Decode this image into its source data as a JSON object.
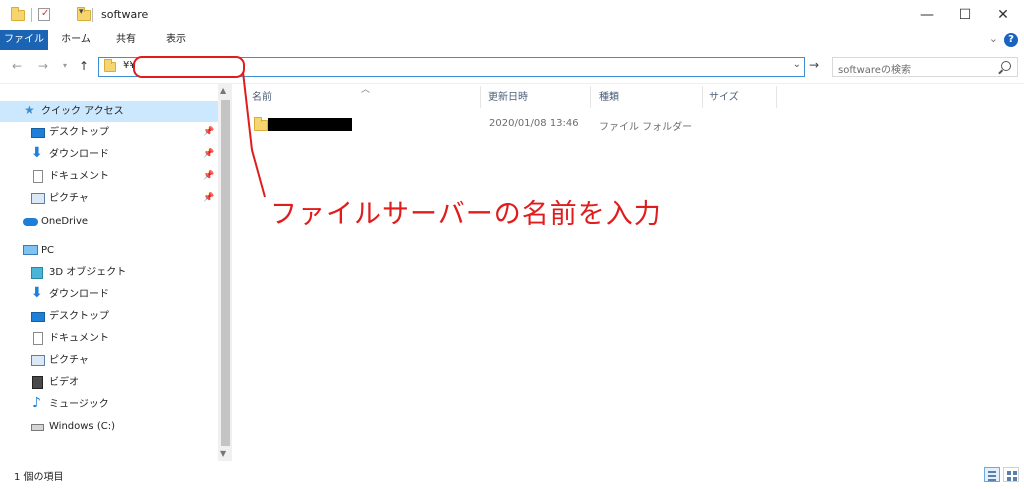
{
  "window": {
    "title": "software",
    "controls": {
      "minimize": "—",
      "maximize": "☐",
      "close": "✕"
    }
  },
  "ribbon": {
    "tabs": [
      {
        "label": "ファイル",
        "active": true
      },
      {
        "label": "ホーム"
      },
      {
        "label": "共有"
      },
      {
        "label": "表示"
      }
    ],
    "help": "?"
  },
  "address": {
    "path": "¥¥",
    "search_placeholder": "softwareの検索"
  },
  "annotation": {
    "text": "ファイルサーバーの名前を入力",
    "color": "#e01c1c"
  },
  "nav_pane": {
    "quick_access": "クイック アクセス",
    "quick_items": [
      {
        "label": "デスクトップ",
        "icon": "desktop-icon"
      },
      {
        "label": "ダウンロード",
        "icon": "download-icon"
      },
      {
        "label": "ドキュメント",
        "icon": "document-icon"
      },
      {
        "label": "ピクチャ",
        "icon": "pictures-icon"
      }
    ],
    "onedrive": "OneDrive",
    "pc": "PC",
    "pc_items": [
      {
        "label": "3D オブジェクト",
        "icon": "cube-icon"
      },
      {
        "label": "ダウンロード",
        "icon": "download-icon"
      },
      {
        "label": "デスクトップ",
        "icon": "desktop-icon"
      },
      {
        "label": "ドキュメント",
        "icon": "document-icon"
      },
      {
        "label": "ピクチャ",
        "icon": "pictures-icon"
      },
      {
        "label": "ビデオ",
        "icon": "video-icon"
      },
      {
        "label": "ミュージック",
        "icon": "music-icon"
      },
      {
        "label": "Windows (C:)",
        "icon": "drive-icon"
      }
    ]
  },
  "columns": {
    "name": "名前",
    "modified": "更新日時",
    "type": "種類",
    "size": "サイズ"
  },
  "rows": [
    {
      "name": "",
      "modified": "2020/01/08 13:46",
      "type": "ファイル フォルダー",
      "size": ""
    }
  ],
  "status": {
    "count": "1 個の項目"
  },
  "colors": {
    "accent": "#1b64b4",
    "address_border": "#3c8fd6",
    "selection": "#cce8ff"
  }
}
